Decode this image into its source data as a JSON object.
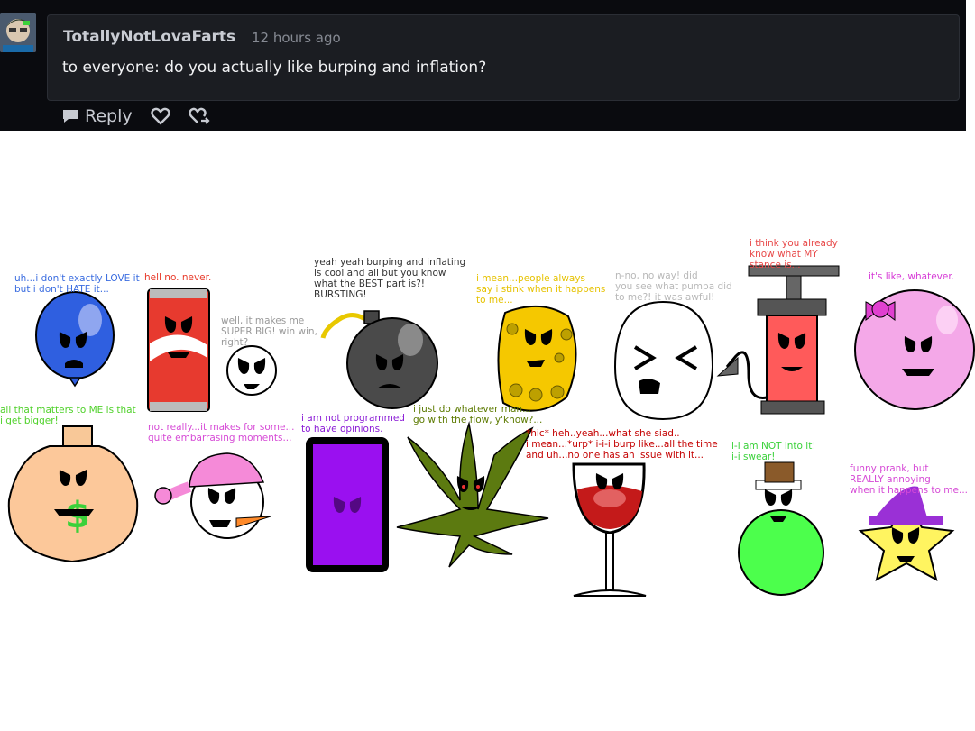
{
  "comment": {
    "username": "TotallyNotLovaFarts",
    "timestamp": "12 hours ago",
    "text": "to everyone: do you actually like burping and inflation?",
    "actions": {
      "reply_label": "Reply"
    }
  },
  "characters": [
    {
      "id": "balloon",
      "text": "uh...i don't exactly LOVE it\nbut i don't HATE it...",
      "color": "#3b6de0"
    },
    {
      "id": "soda-can",
      "text": "hell no. never.",
      "color": "#e83a2a"
    },
    {
      "id": "ball",
      "text": "well, it makes me\nSUPER BIG! win win,\nright?",
      "color": "#9a9a9a"
    },
    {
      "id": "bomb",
      "text": "yeah yeah burping and inflating\nis cool and all but you know\nwhat the BEST part is?!\nBURSTING!",
      "color": "#333333"
    },
    {
      "id": "sponge",
      "text": "i mean...people always\nsay i stink when it happens\nto me...",
      "color": "#e6c200"
    },
    {
      "id": "egg",
      "text": "n-no, no way! did\nyou see what pumpa did\nto me?! it was awful!",
      "color": "#b8b8b8"
    },
    {
      "id": "pump",
      "text": "i think you already\nknow what MY\nstance is...",
      "color": "#e84a4a"
    },
    {
      "id": "pink-ball",
      "text": "it's like, whatever.",
      "color": "#d63ad6"
    },
    {
      "id": "money-bag",
      "text": "all that matters to ME is that\ni get bigger!",
      "color": "#4fd12a"
    },
    {
      "id": "snowman",
      "text": "not really...it makes for some...\nquite embarrasing moments...",
      "color": "#d64ad6"
    },
    {
      "id": "phone",
      "text": "i am not programmed\nto have opinions.",
      "color": "#8a1ad6"
    },
    {
      "id": "weed-leaf",
      "text": "i just do whatever man...\ngo with the flow, y'know?...",
      "color": "#5c7a00"
    },
    {
      "id": "wine-glass",
      "text": "*hic* heh..yeah...what she siad..\ni mean...*urp* i-i-i burp like...all the time\nand uh...no one has an issue with it...",
      "color": "#c40000"
    },
    {
      "id": "green-ball",
      "text": "i-i am NOT into it!\ni-i swear!",
      "color": "#3ad13a"
    },
    {
      "id": "star",
      "text": "funny prank, but\nREALLY annoying\nwhen it happens to me...",
      "color": "#d64ad6"
    }
  ]
}
